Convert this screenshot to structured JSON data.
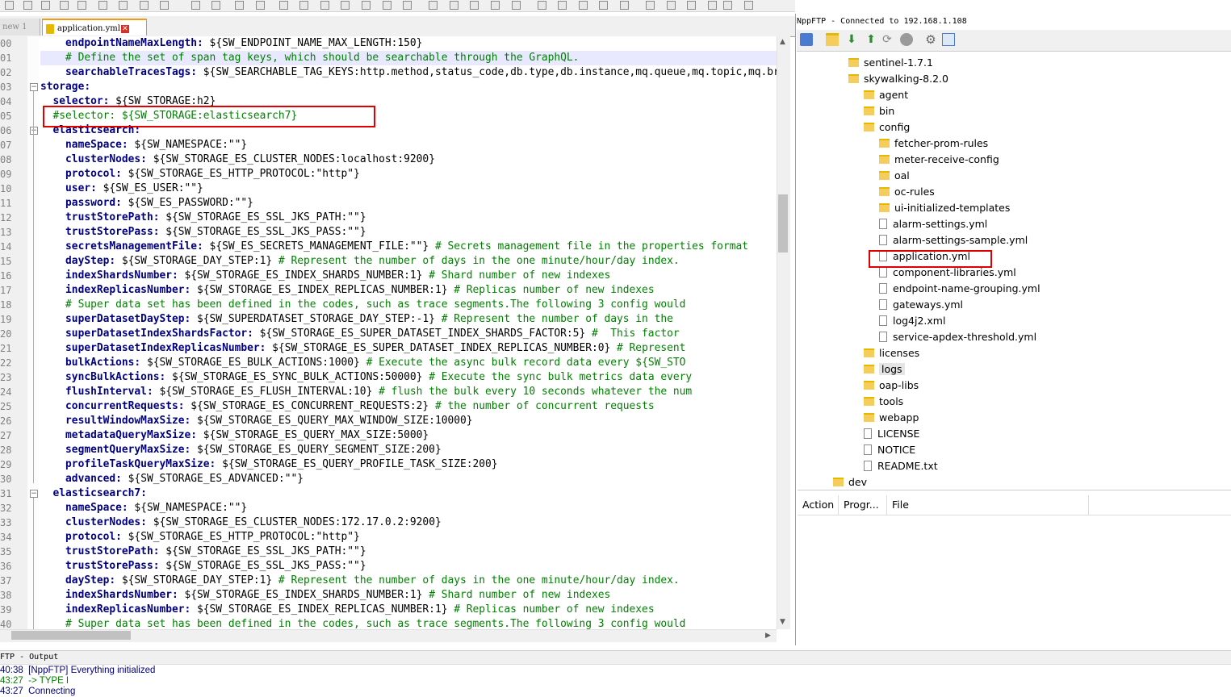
{
  "tabs": [
    {
      "label": "new 1"
    },
    {
      "label": "application.yml"
    }
  ],
  "editor": {
    "lines": [
      {
        "num": "00",
        "indent": "    ",
        "key": "endpointNameMaxLength:",
        "val": " ${SW_ENDPOINT_NAME_MAX_LENGTH:150}",
        "comment": ""
      },
      {
        "num": "01",
        "indent": "    ",
        "key": "",
        "val": "",
        "comment": "# Define the set of span tag keys, which should be searchable through the GraphQL."
      },
      {
        "num": "02",
        "indent": "    ",
        "key": "searchableTracesTags:",
        "val": " ${SW_SEARCHABLE_TAG_KEYS:http.method,status_code,db.type,db.instance,mq.queue,mq.topic,mq.broker}",
        "comment": ""
      },
      {
        "num": "03",
        "indent": "",
        "key": "storage:",
        "val": "",
        "comment": ""
      },
      {
        "num": "04",
        "indent": "  ",
        "key": "selector:",
        "val": " ${SW_STORAGE:h2}",
        "comment": ""
      },
      {
        "num": "05",
        "indent": "  ",
        "key": "",
        "val": "",
        "comment": "#selector: ${SW_STORAGE:elasticsearch7}"
      },
      {
        "num": "06",
        "indent": "  ",
        "key": "elasticsearch:",
        "val": "",
        "comment": ""
      },
      {
        "num": "07",
        "indent": "    ",
        "key": "nameSpace:",
        "val": " ${SW_NAMESPACE:\"\"}",
        "comment": ""
      },
      {
        "num": "08",
        "indent": "    ",
        "key": "clusterNodes:",
        "val": " ${SW_STORAGE_ES_CLUSTER_NODES:localhost:9200}",
        "comment": ""
      },
      {
        "num": "09",
        "indent": "    ",
        "key": "protocol:",
        "val": " ${SW_STORAGE_ES_HTTP_PROTOCOL:\"http\"}",
        "comment": ""
      },
      {
        "num": "10",
        "indent": "    ",
        "key": "user:",
        "val": " ${SW_ES_USER:\"\"}",
        "comment": ""
      },
      {
        "num": "11",
        "indent": "    ",
        "key": "password:",
        "val": " ${SW_ES_PASSWORD:\"\"}",
        "comment": ""
      },
      {
        "num": "12",
        "indent": "    ",
        "key": "trustStorePath:",
        "val": " ${SW_STORAGE_ES_SSL_JKS_PATH:\"\"}",
        "comment": ""
      },
      {
        "num": "13",
        "indent": "    ",
        "key": "trustStorePass:",
        "val": " ${SW_STORAGE_ES_SSL_JKS_PASS:\"\"}",
        "comment": ""
      },
      {
        "num": "14",
        "indent": "    ",
        "key": "secretsManagementFile:",
        "val": " ${SW_ES_SECRETS_MANAGEMENT_FILE:\"\"}",
        "comment": " # Secrets management file in the properties format"
      },
      {
        "num": "15",
        "indent": "    ",
        "key": "dayStep:",
        "val": " ${SW_STORAGE_DAY_STEP:1}",
        "comment": " # Represent the number of days in the one minute/hour/day index."
      },
      {
        "num": "16",
        "indent": "    ",
        "key": "indexShardsNumber:",
        "val": " ${SW_STORAGE_ES_INDEX_SHARDS_NUMBER:1}",
        "comment": " # Shard number of new indexes"
      },
      {
        "num": "17",
        "indent": "    ",
        "key": "indexReplicasNumber:",
        "val": " ${SW_STORAGE_ES_INDEX_REPLICAS_NUMBER:1}",
        "comment": " # Replicas number of new indexes"
      },
      {
        "num": "18",
        "indent": "    ",
        "key": "",
        "val": "",
        "comment": "# Super data set has been defined in the codes, such as trace segments.The following 3 config would"
      },
      {
        "num": "19",
        "indent": "    ",
        "key": "superDatasetDayStep:",
        "val": " ${SW_SUPERDATASET_STORAGE_DAY_STEP:-1}",
        "comment": " # Represent the number of days in the"
      },
      {
        "num": "20",
        "indent": "    ",
        "key": "superDatasetIndexShardsFactor:",
        "val": " ${SW_STORAGE_ES_SUPER_DATASET_INDEX_SHARDS_FACTOR:5}",
        "comment": " #  This factor"
      },
      {
        "num": "21",
        "indent": "    ",
        "key": "superDatasetIndexReplicasNumber:",
        "val": " ${SW_STORAGE_ES_SUPER_DATASET_INDEX_REPLICAS_NUMBER:0}",
        "comment": " # Represent"
      },
      {
        "num": "22",
        "indent": "    ",
        "key": "bulkActions:",
        "val": " ${SW_STORAGE_ES_BULK_ACTIONS:1000}",
        "comment": " # Execute the async bulk record data every ${SW_STO"
      },
      {
        "num": "23",
        "indent": "    ",
        "key": "syncBulkActions:",
        "val": " ${SW_STORAGE_ES_SYNC_BULK_ACTIONS:50000}",
        "comment": " # Execute the sync bulk metrics data every"
      },
      {
        "num": "24",
        "indent": "    ",
        "key": "flushInterval:",
        "val": " ${SW_STORAGE_ES_FLUSH_INTERVAL:10}",
        "comment": " # flush the bulk every 10 seconds whatever the num"
      },
      {
        "num": "25",
        "indent": "    ",
        "key": "concurrentRequests:",
        "val": " ${SW_STORAGE_ES_CONCURRENT_REQUESTS:2}",
        "comment": " # the number of concurrent requests"
      },
      {
        "num": "26",
        "indent": "    ",
        "key": "resultWindowMaxSize:",
        "val": " ${SW_STORAGE_ES_QUERY_MAX_WINDOW_SIZE:10000}",
        "comment": ""
      },
      {
        "num": "27",
        "indent": "    ",
        "key": "metadataQueryMaxSize:",
        "val": " ${SW_STORAGE_ES_QUERY_MAX_SIZE:5000}",
        "comment": ""
      },
      {
        "num": "28",
        "indent": "    ",
        "key": "segmentQueryMaxSize:",
        "val": " ${SW_STORAGE_ES_QUERY_SEGMENT_SIZE:200}",
        "comment": ""
      },
      {
        "num": "29",
        "indent": "    ",
        "key": "profileTaskQueryMaxSize:",
        "val": " ${SW_STORAGE_ES_QUERY_PROFILE_TASK_SIZE:200}",
        "comment": ""
      },
      {
        "num": "30",
        "indent": "    ",
        "key": "advanced:",
        "val": " ${SW_STORAGE_ES_ADVANCED:\"\"}",
        "comment": ""
      },
      {
        "num": "31",
        "indent": "  ",
        "key": "elasticsearch7:",
        "val": "",
        "comment": ""
      },
      {
        "num": "32",
        "indent": "    ",
        "key": "nameSpace:",
        "val": " ${SW_NAMESPACE:\"\"}",
        "comment": ""
      },
      {
        "num": "33",
        "indent": "    ",
        "key": "clusterNodes:",
        "val": " ${SW_STORAGE_ES_CLUSTER_NODES:172.17.0.2:9200}",
        "comment": ""
      },
      {
        "num": "34",
        "indent": "    ",
        "key": "protocol:",
        "val": " ${SW_STORAGE_ES_HTTP_PROTOCOL:\"http\"}",
        "comment": ""
      },
      {
        "num": "35",
        "indent": "    ",
        "key": "trustStorePath:",
        "val": " ${SW_STORAGE_ES_SSL_JKS_PATH:\"\"}",
        "comment": ""
      },
      {
        "num": "36",
        "indent": "    ",
        "key": "trustStorePass:",
        "val": " ${SW_STORAGE_ES_SSL_JKS_PASS:\"\"}",
        "comment": ""
      },
      {
        "num": "37",
        "indent": "    ",
        "key": "dayStep:",
        "val": " ${SW_STORAGE_DAY_STEP:1}",
        "comment": " # Represent the number of days in the one minute/hour/day index."
      },
      {
        "num": "38",
        "indent": "    ",
        "key": "indexShardsNumber:",
        "val": " ${SW_STORAGE_ES_INDEX_SHARDS_NUMBER:1}",
        "comment": " # Shard number of new indexes"
      },
      {
        "num": "39",
        "indent": "    ",
        "key": "indexReplicasNumber:",
        "val": " ${SW_STORAGE_ES_INDEX_REPLICAS_NUMBER:1}",
        "comment": " # Replicas number of new indexes"
      },
      {
        "num": "40",
        "indent": "    ",
        "key": "",
        "val": "",
        "comment": "# Super data set has been defined in the codes, such as trace segments.The following 3 config would"
      }
    ]
  },
  "ftp": {
    "title": "NppFTP - Connected to 192.168.1.108",
    "tree": [
      {
        "label": "sentinel-1.7.1",
        "type": "folder",
        "level": 2
      },
      {
        "label": "skywalking-8.2.0",
        "type": "folder",
        "level": 2
      },
      {
        "label": "agent",
        "type": "folder",
        "level": 3
      },
      {
        "label": "bin",
        "type": "folder",
        "level": 3
      },
      {
        "label": "config",
        "type": "folder",
        "level": 3
      },
      {
        "label": "fetcher-prom-rules",
        "type": "folder",
        "level": 4
      },
      {
        "label": "meter-receive-config",
        "type": "folder",
        "level": 4
      },
      {
        "label": "oal",
        "type": "folder",
        "level": 4
      },
      {
        "label": "oc-rules",
        "type": "folder",
        "level": 4
      },
      {
        "label": "ui-initialized-templates",
        "type": "folder",
        "level": 4
      },
      {
        "label": "alarm-settings.yml",
        "type": "file",
        "level": 4
      },
      {
        "label": "alarm-settings-sample.yml",
        "type": "file",
        "level": 4
      },
      {
        "label": "application.yml",
        "type": "file",
        "level": 4
      },
      {
        "label": "component-libraries.yml",
        "type": "file",
        "level": 4
      },
      {
        "label": "endpoint-name-grouping.yml",
        "type": "file",
        "level": 4
      },
      {
        "label": "gateways.yml",
        "type": "file",
        "level": 4
      },
      {
        "label": "log4j2.xml",
        "type": "file",
        "level": 4
      },
      {
        "label": "service-apdex-threshold.yml",
        "type": "file",
        "level": 4
      },
      {
        "label": "licenses",
        "type": "folder",
        "level": 3
      },
      {
        "label": "logs",
        "type": "folder",
        "level": 3,
        "selected": true
      },
      {
        "label": "oap-libs",
        "type": "folder",
        "level": 3
      },
      {
        "label": "tools",
        "type": "folder",
        "level": 3
      },
      {
        "label": "webapp",
        "type": "folder",
        "level": 3
      },
      {
        "label": "LICENSE",
        "type": "file",
        "level": 3
      },
      {
        "label": "NOTICE",
        "type": "file",
        "level": 3
      },
      {
        "label": "README.txt",
        "type": "file",
        "level": 3
      },
      {
        "label": "dev",
        "type": "folder",
        "level": 1
      }
    ],
    "queue_columns": [
      "Action",
      "Progr...",
      "File"
    ]
  },
  "output": {
    "title": "FTP - Output",
    "lines": [
      {
        "time": "40:38",
        "msg": "[NppFTP] Everything initialized",
        "color": "#000080"
      },
      {
        "time": "43:27",
        "msg": "-> TYPE I",
        "color": "#008000"
      },
      {
        "time": "43:27",
        "msg": "Connecting",
        "color": "#000080"
      }
    ]
  },
  "colors": {
    "key": "#000080",
    "comment": "#008000",
    "highlight": "#e00000"
  }
}
